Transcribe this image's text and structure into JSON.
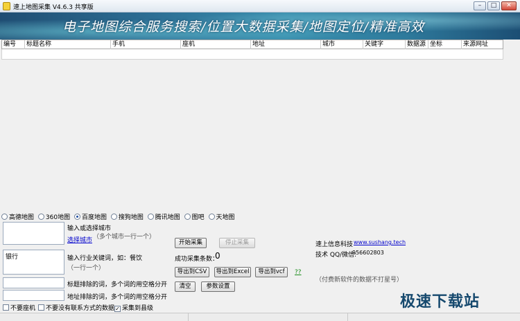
{
  "window": {
    "title": "速上地图采集 V4.6.3 共享版",
    "btn_min": "–",
    "btn_max": "□",
    "btn_close": "✕"
  },
  "banner": {
    "slogan": "电子地图综合服务搜索/位置大数据采集/地图定位/精准高效"
  },
  "table": {
    "columns": [
      "编号",
      "标题名称",
      "手机",
      "座机",
      "地址",
      "城市",
      "关键字",
      "数据源",
      "坐标",
      "来源网址"
    ]
  },
  "map_sources": {
    "options": [
      "高德地图",
      "360地图",
      "百度地图",
      "搜狗地图",
      "腾讯地图",
      "图吧",
      "天地图"
    ],
    "selected": "百度地图"
  },
  "city": {
    "value": "",
    "label": "输入或选择城市",
    "select_link": "选择城市",
    "hint": "（多个城市一行一个）"
  },
  "keyword": {
    "value": "银行",
    "label": "输入行业关键词，如：餐饮",
    "hint": "（一行一个）"
  },
  "exclude_title": {
    "value": "",
    "label": "标题排除的词，多个词的用空格分开"
  },
  "exclude_address": {
    "value": "",
    "label": "地址排除的词，多个词的用空格分开"
  },
  "options": {
    "no_landline": "不要座机",
    "no_contact": "不要没有联系方式的数据",
    "to_county": "采集到县级",
    "to_county_checked": true,
    "check_mark": "✓"
  },
  "actions": {
    "start": "开始采集",
    "stop": "停止采集",
    "success_label": "成功采集条数：",
    "success_count": "0",
    "export_csv": "导出到CSV",
    "export_excel": "导出到Excel",
    "export_vcf": "导出到vcf",
    "help": "??",
    "clear": "清空",
    "settings": "参数设置"
  },
  "company": {
    "name": "速上信息科技",
    "website": "www.sushang.tech",
    "contact_label": "技术 QQ/微信:",
    "contact_value": "956602803",
    "note": "（付费新软件的数据不打星号）"
  },
  "watermark": {
    "text": "极速下载站"
  },
  "colors": {
    "banner_primary": "#2d6f95",
    "link": "#0000cc",
    "watermark": "#16496e"
  }
}
